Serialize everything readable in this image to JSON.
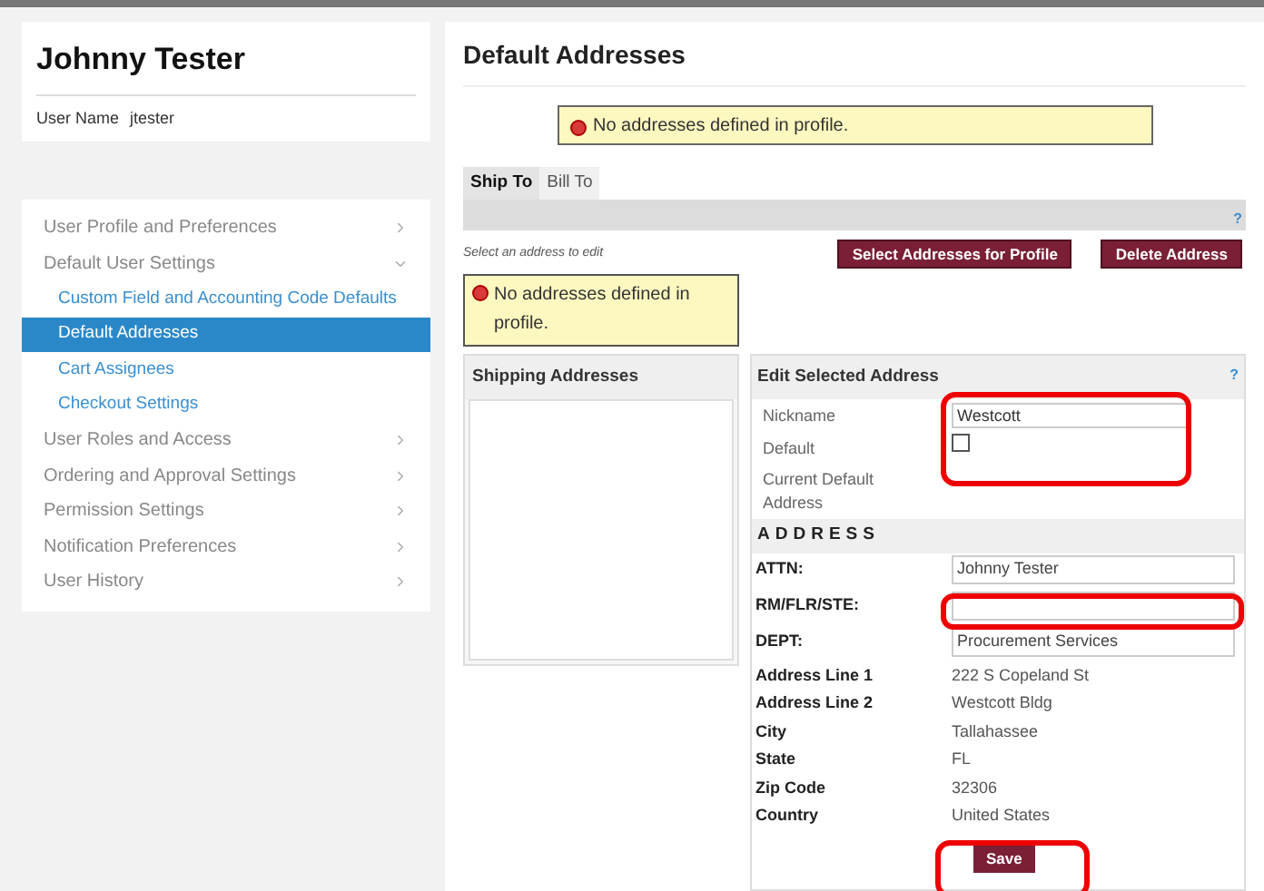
{
  "profile": {
    "name": "Johnny Tester",
    "username_label": "User Name",
    "username": "jtester"
  },
  "menu": [
    {
      "label": "User Profile and Preferences",
      "expanded": false
    },
    {
      "label": "Default User Settings",
      "expanded": true,
      "children": [
        {
          "label": "Custom Field and Accounting Code Defaults",
          "selected": false
        },
        {
          "label": "Default Addresses",
          "selected": true
        },
        {
          "label": "Cart Assignees",
          "selected": false
        },
        {
          "label": "Checkout Settings",
          "selected": false
        }
      ]
    },
    {
      "label": "User Roles and Access",
      "expanded": false
    },
    {
      "label": "Ordering and Approval Settings",
      "expanded": false
    },
    {
      "label": "Permission Settings",
      "expanded": false
    },
    {
      "label": "Notification Preferences",
      "expanded": false
    },
    {
      "label": "User History",
      "expanded": false
    }
  ],
  "page_title": "Default Addresses",
  "alert": "No addresses defined in profile.",
  "tabs": [
    {
      "label": "Ship To",
      "selected": true
    },
    {
      "label": "Bill To",
      "selected": false
    }
  ],
  "help": "?",
  "hint": "Select an address to edit",
  "buttons": [
    "Select Addresses for Profile",
    "Delete Address"
  ],
  "list_alert": "No addresses defined in profile.",
  "shipping_title": "Shipping Addresses",
  "edit": {
    "title": "Edit Selected Address",
    "help": "?",
    "nickname": {
      "label": "Nickname",
      "value": "Westcott"
    },
    "default": {
      "label": "Default",
      "checked": false
    },
    "current_default_label": "Current Default Address",
    "address_heading": "ADDRESS",
    "inputs": [
      {
        "label": "ATTN:",
        "value": "Johnny Tester"
      },
      {
        "label": "RM/FLR/STE:"
      },
      {
        "label": "DEPT:",
        "value": "Procurement Services"
      }
    ],
    "details": [
      {
        "label": "Address Line 1",
        "value": "222 S Copeland St"
      },
      {
        "label": "Address Line 2",
        "value": "Westcott Bldg"
      },
      {
        "label": "City",
        "value": "Tallahassee"
      },
      {
        "label": "State",
        "value": "FL"
      },
      {
        "label": "Zip Code",
        "value": "32306"
      },
      {
        "label": "Country",
        "value": "United States"
      }
    ],
    "save": "Save"
  }
}
